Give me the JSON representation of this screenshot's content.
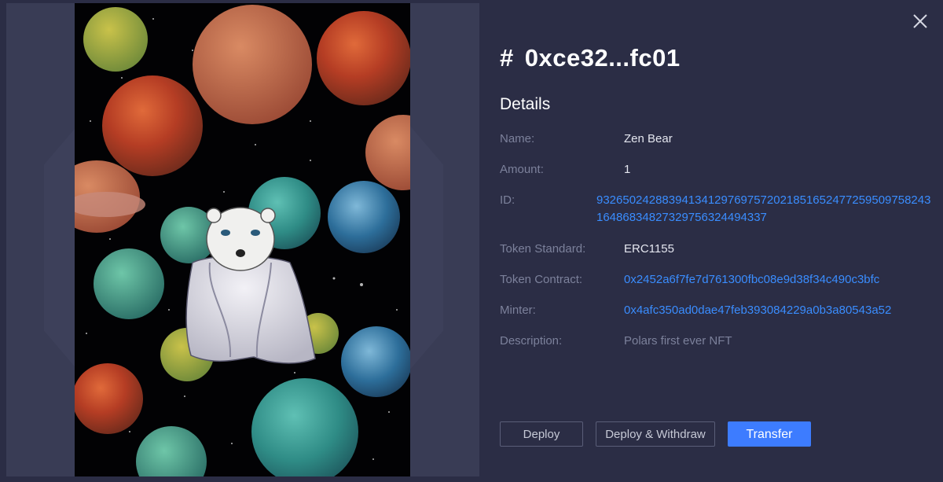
{
  "nft": {
    "title_prefix": "#",
    "title_id": "0xce32...fc01",
    "section_title": "Details",
    "fields": {
      "name": {
        "label": "Name:",
        "value": "Zen Bear"
      },
      "amount": {
        "label": "Amount:",
        "value": "1"
      },
      "id": {
        "label": "ID:",
        "value": "93265024288394134129769757202185165247725950975824316486834827329756324494337"
      },
      "token_standard": {
        "label": "Token Standard:",
        "value": "ERC1155"
      },
      "token_contract": {
        "label": "Token Contract:",
        "value": "0x2452a6f7fe7d761300fbc08e9d38f34c490c3bfc"
      },
      "minter": {
        "label": "Minter:",
        "value": "0x4afc350ad0dae47feb393084229a0b3a80543a52"
      },
      "description": {
        "label": "Description:",
        "value": "Polars first ever NFT"
      }
    }
  },
  "actions": {
    "deploy": "Deploy",
    "deploy_withdraw": "Deploy & Withdraw",
    "transfer": "Transfer"
  },
  "icons": {
    "close": "close-icon"
  },
  "colors": {
    "background": "#2b2d45",
    "link": "#3a8dff",
    "primary_button": "#3d7cff",
    "label": "#7c819b"
  }
}
